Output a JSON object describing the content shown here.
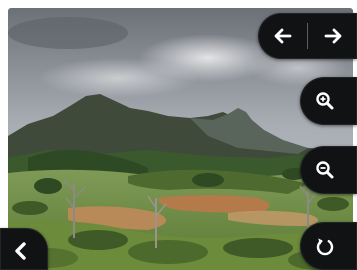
{
  "viewer": {
    "photo_subject": "landscape-photo",
    "controls": {
      "prev_icon": "arrow-left-icon",
      "next_icon": "arrow-right-icon",
      "zoom_in_icon": "magnifier-plus-icon",
      "zoom_out_icon": "magnifier-minus-icon",
      "rotate_icon": "rotate-icon",
      "back_icon": "chevron-left-icon"
    },
    "colors": {
      "control_background": "#111214",
      "icon": "#ffffff",
      "divider": "#5a5d63"
    }
  }
}
